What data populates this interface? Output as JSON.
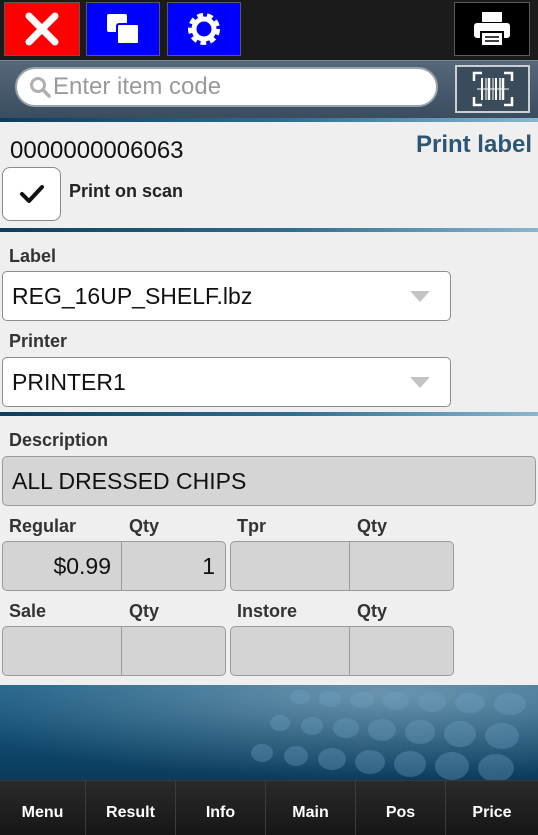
{
  "toolbar": {
    "close_icon": "close-icon",
    "windows_icon": "windows-icon",
    "settings_icon": "gear-icon",
    "print_icon": "printer-icon"
  },
  "search": {
    "placeholder": "Enter item code",
    "value": ""
  },
  "item": {
    "code": "0000000006063",
    "action_title": "Print label",
    "print_on_scan_label": "Print on scan",
    "print_on_scan_checked": true
  },
  "label_field": {
    "label": "Label",
    "value": "REG_16UP_SHELF.lbz"
  },
  "printer_field": {
    "label": "Printer",
    "value": "PRINTER1"
  },
  "description": {
    "label": "Description",
    "value": "ALL DRESSED CHIPS"
  },
  "prices": {
    "regular": {
      "label": "Regular",
      "qty_label": "Qty",
      "price": "$0.99",
      "qty": "1"
    },
    "tpr": {
      "label": "Tpr",
      "qty_label": "Qty",
      "price": "",
      "qty": ""
    },
    "sale": {
      "label": "Sale",
      "qty_label": "Qty",
      "price": "",
      "qty": ""
    },
    "instore": {
      "label": "Instore",
      "qty_label": "Qty",
      "price": "",
      "qty": ""
    }
  },
  "bottom_nav": [
    "Menu",
    "Result",
    "Info",
    "Main",
    "Pos",
    "Price"
  ],
  "colors": {
    "close_button": "#ff0000",
    "blue_button": "#0000ff",
    "title_accent": "#2d5675"
  }
}
